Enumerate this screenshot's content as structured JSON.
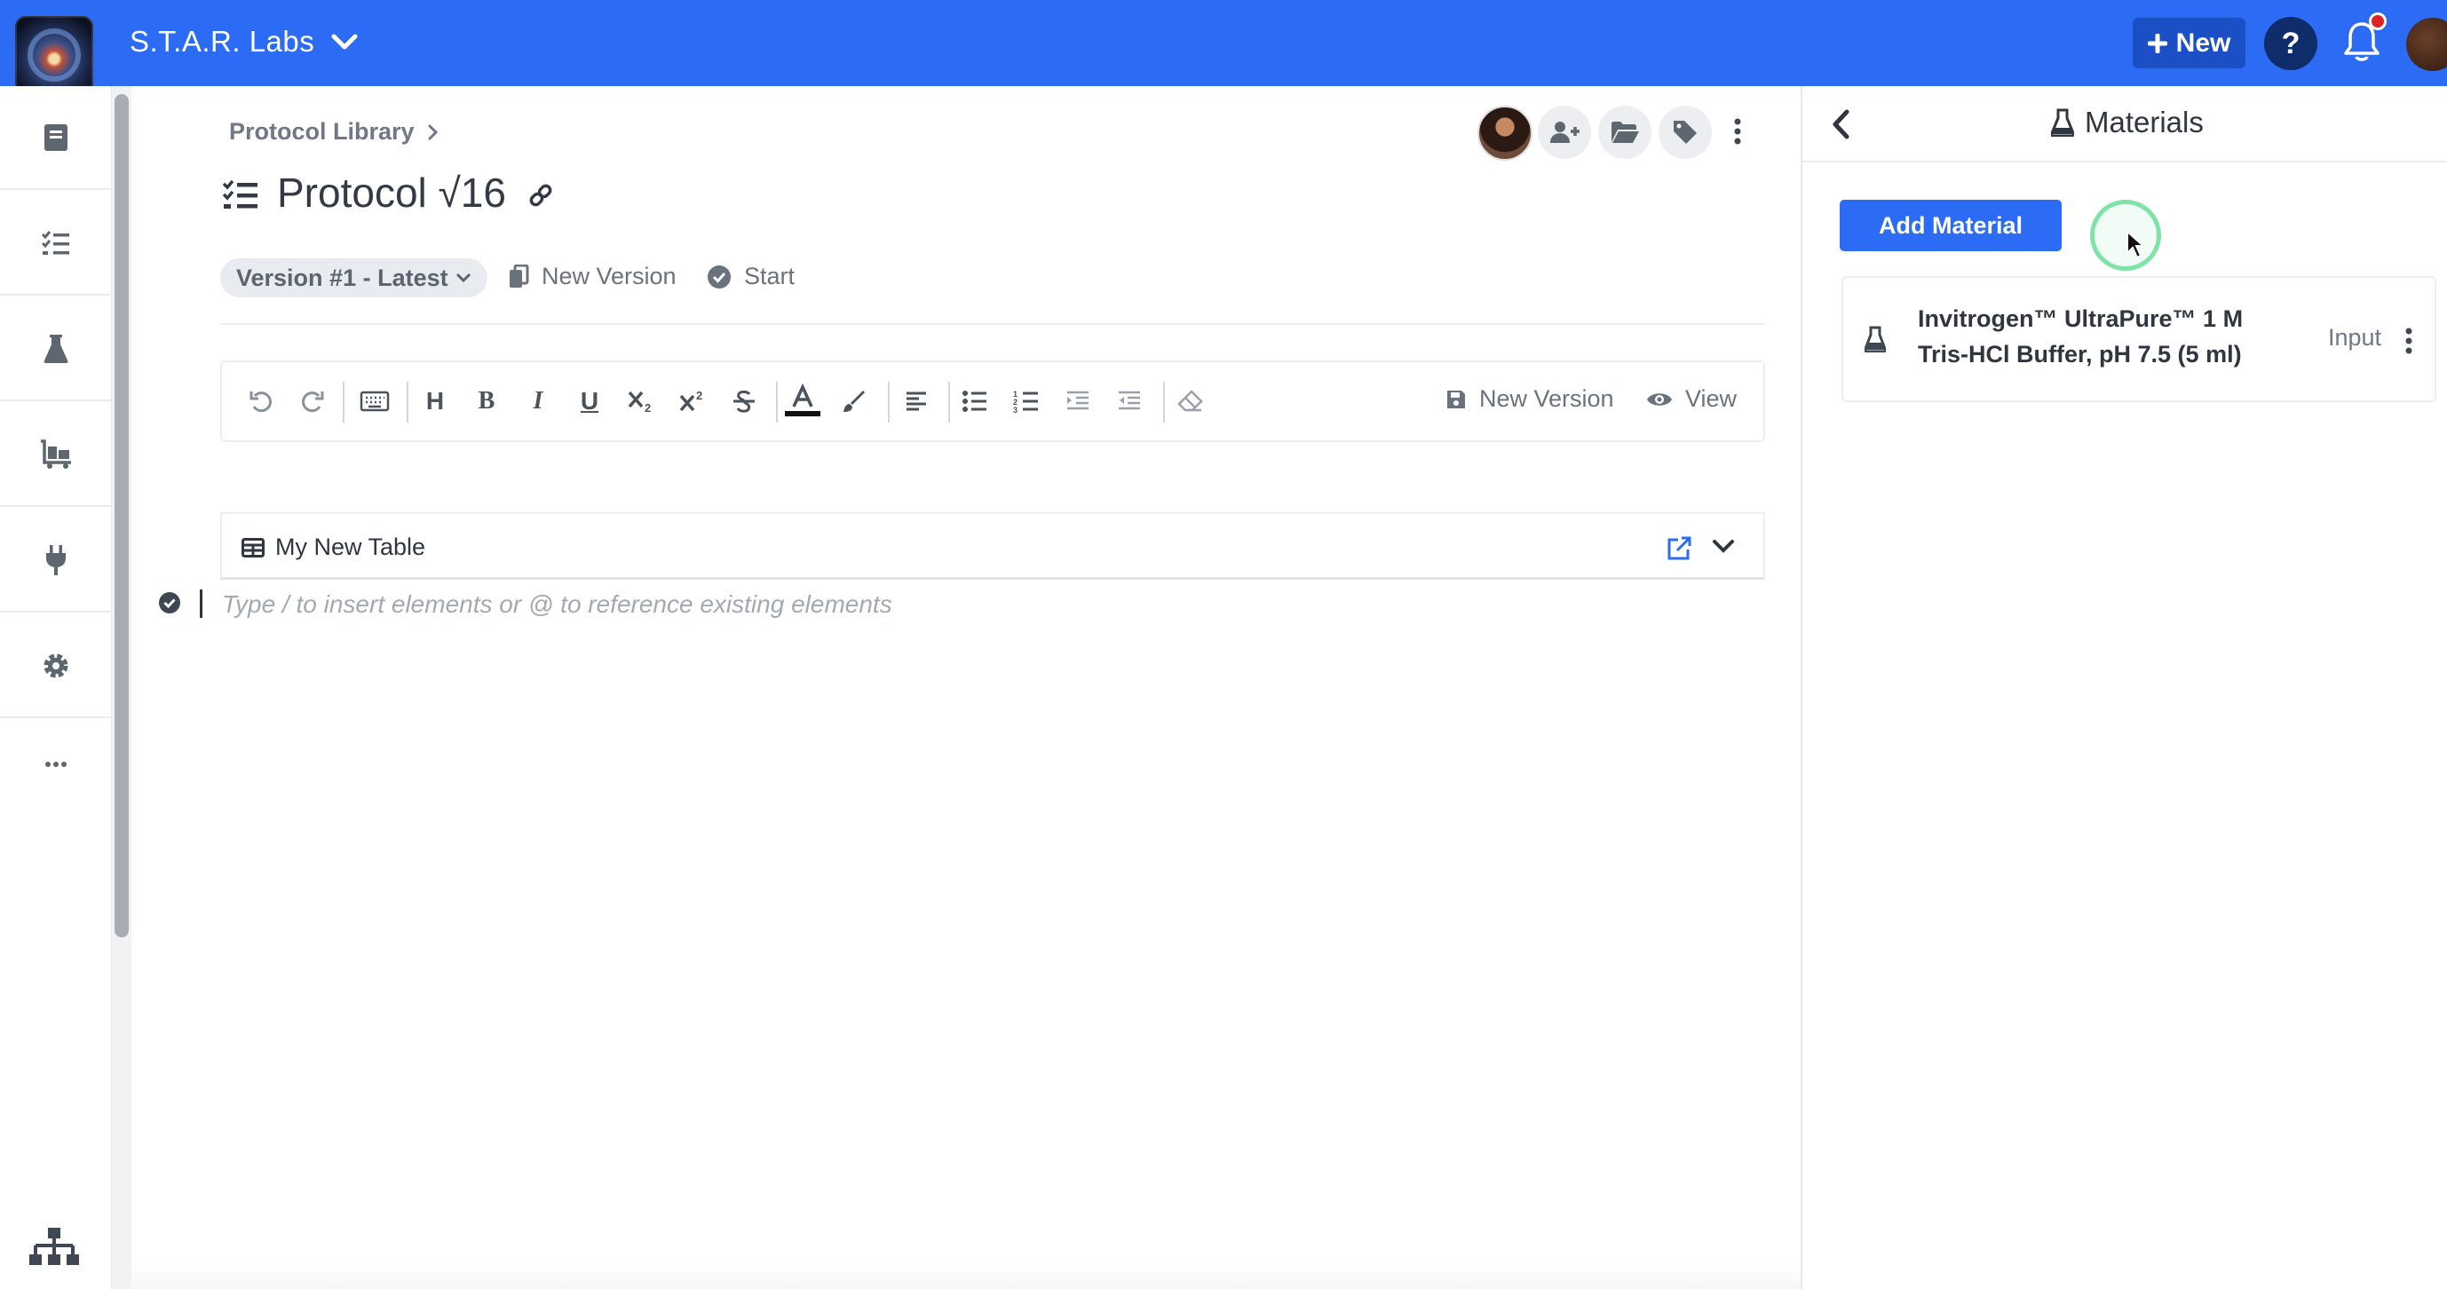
{
  "header": {
    "org_name": "S.T.A.R. Labs",
    "new_label": "New",
    "help_label": "?"
  },
  "sidebar": {
    "items": [
      {
        "icon": "notebook-icon"
      },
      {
        "icon": "protocols-list-icon"
      },
      {
        "icon": "flask-icon"
      },
      {
        "icon": "inventory-icon"
      },
      {
        "icon": "plug-icon"
      },
      {
        "icon": "gear-icon"
      },
      {
        "icon": "more-horizontal-icon"
      }
    ],
    "bottom_icon": "sitemap-icon"
  },
  "protocol": {
    "breadcrumb": "Protocol Library",
    "title": "Protocol √16",
    "version_label": "Version #1 - Latest",
    "new_version_label": "New Version",
    "start_label": "Start"
  },
  "editor_toolbar": {
    "new_version_label": "New Version",
    "view_label": "View",
    "heading_label": "H",
    "bold_label": "B",
    "italic_label": "I",
    "underline_label": "U"
  },
  "table_block": {
    "title": "My New Table"
  },
  "editor": {
    "placeholder": "Type / to insert elements or @ to reference existing elements"
  },
  "materials_panel": {
    "title": "Materials",
    "add_button": "Add Material",
    "materials": [
      {
        "name": "Invitrogen™ UltraPure™ 1 M Tris-HCl Buffer, pH 7.5 (5 ml)",
        "role": "Input"
      }
    ]
  },
  "colors": {
    "brand_blue": "#2c6cf4",
    "dark_navy": "#0f2d6b",
    "notification_red": "#e02222"
  }
}
